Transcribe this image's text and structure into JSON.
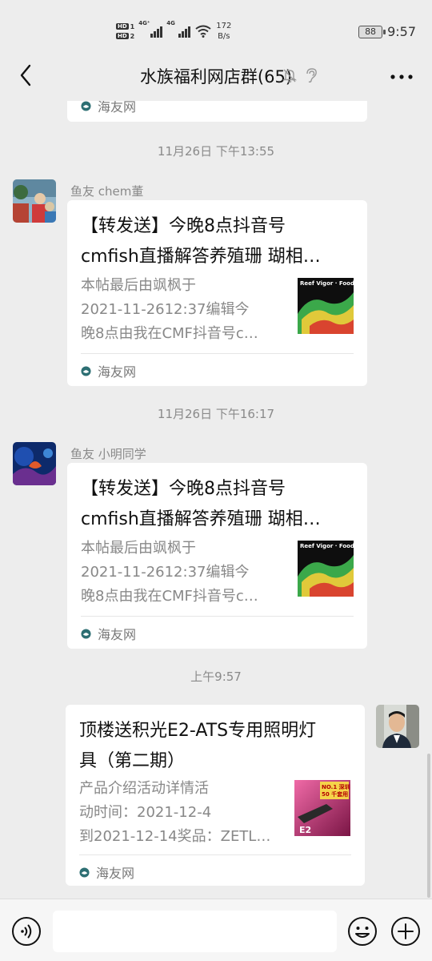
{
  "status_bar": {
    "hd1": "HD",
    "hd2": "HD",
    "sim1": "4G⁺",
    "sim2": "4G",
    "speed_value": "172",
    "speed_unit": "B/s",
    "battery": "88",
    "time": "9:57"
  },
  "header": {
    "title": "水族福利网店群(65)"
  },
  "partial_card": {
    "source": "海友网"
  },
  "messages": [
    {
      "timestamp": "11月26日 下午13:55",
      "sender": "鱼友 chem董",
      "title_line1": "【转发送】今晚8点抖音号",
      "title_line2": "cmfish直播解答养殖珊 瑚相…",
      "desc_line1": "本帖最后由飒枫于",
      "desc_line2": "2021-11-2612:37编辑今",
      "desc_line3": "晚8点由我在CMF抖音号c…",
      "thumb_text": "Reef Vigor · Food",
      "source": "海友网"
    },
    {
      "timestamp": "11月26日 下午16:17",
      "sender": "鱼友 小明同学",
      "title_line1": "【转发送】今晚8点抖音号",
      "title_line2": "cmfish直播解答养殖珊 瑚相…",
      "desc_line1": "本帖最后由飒枫于",
      "desc_line2": "2021-11-2612:37编辑今",
      "desc_line3": "晚8点由我在CMF抖音号c…",
      "thumb_text": "Reef Vigor · Food",
      "source": "海友网"
    },
    {
      "timestamp": "上午9:57",
      "title_line1": "顶楼送积光E2-ATS专用照明灯",
      "title_line2": "具（第二期）",
      "desc_line1": "产品介绍活动详情活",
      "desc_line2": "动时间：2021-12-4",
      "desc_line3": "到2021-12-14奖品：ZETL…",
      "thumb_text_1": "NO.1 深圳",
      "thumb_text_2": "50 千套用",
      "thumb_text_3": "E2",
      "source": "海友网"
    }
  ],
  "input": {
    "placeholder": ""
  },
  "icons": {
    "back": "chevron-left-icon",
    "mute": "bell-off-icon",
    "earpiece": "ear-icon",
    "more": "more-horizontal-icon",
    "voice": "voice-icon",
    "emoji": "smiley-icon",
    "plus": "plus-circle-icon",
    "source": "haiyou-logo-icon"
  },
  "colors": {
    "background": "#ededed",
    "card": "#ffffff",
    "meta_text": "#8a8a8a"
  }
}
